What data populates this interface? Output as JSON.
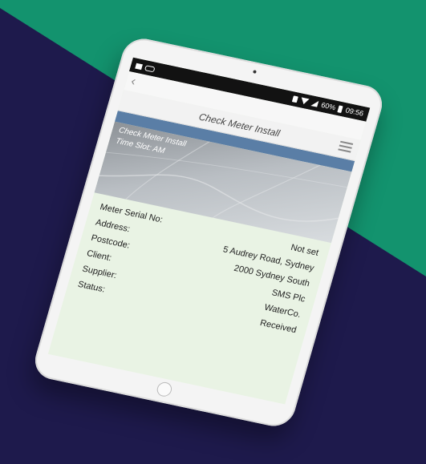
{
  "colors": {
    "background": "#1e1a4c",
    "accent_green": "#13936e",
    "header_blue": "#5a7ea6",
    "card_bg": "#e9f3e4"
  },
  "statusbar": {
    "icons_left": [
      "image-icon",
      "voicemail-icon"
    ],
    "battery": "60%",
    "time": "09:56"
  },
  "header": {
    "title": "Check Meter Install"
  },
  "hero": {
    "title": "Check Meter Install",
    "subtitle": "Time Slot: AM"
  },
  "details": [
    {
      "label": "Meter Serial No:",
      "value": "Not set"
    },
    {
      "label": "Address:",
      "value": "5 Audrey Road, Sydney"
    },
    {
      "label": "Postcode:",
      "value": "2000 Sydney South"
    },
    {
      "label": "Client:",
      "value": "SMS Plc"
    },
    {
      "label": "Supplier:",
      "value": "WaterCo."
    },
    {
      "label": "Status:",
      "value": "Received"
    }
  ]
}
